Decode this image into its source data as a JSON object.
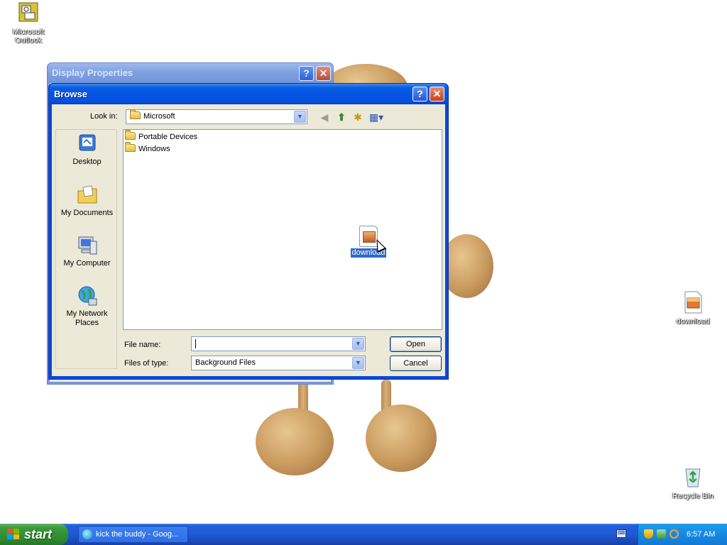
{
  "desktop": {
    "icons": [
      {
        "label": "Microsoft Outlook",
        "icon": "outlook-icon"
      },
      {
        "label": "download",
        "icon": "image-file-icon"
      },
      {
        "label": "Recycle Bin",
        "icon": "recycle-bin-icon"
      }
    ]
  },
  "display_properties": {
    "title": "Display Properties",
    "help_glyph": "?",
    "close_glyph": "✕"
  },
  "browse": {
    "title": "Browse",
    "help_glyph": "?",
    "close_glyph": "✕",
    "look_in_label": "Look in:",
    "look_in_value": "Microsoft",
    "places": [
      {
        "label": "Desktop",
        "icon": "desktop-icon"
      },
      {
        "label": "My Documents",
        "icon": "my-documents-icon"
      },
      {
        "label": "My Computer",
        "icon": "my-computer-icon"
      },
      {
        "label": "My Network Places",
        "icon": "network-places-icon"
      }
    ],
    "files": [
      {
        "name": "Portable Devices",
        "type": "folder"
      },
      {
        "name": "Windows",
        "type": "folder"
      }
    ],
    "dragged_item_label": "download",
    "file_name_label": "File name:",
    "file_name_value": "",
    "files_of_type_label": "Files of type:",
    "files_of_type_value": "Background Files",
    "open_label": "Open",
    "cancel_label": "Cancel",
    "nav_glyphs": {
      "back": "◀",
      "up": "⬆",
      "new_folder": "✱",
      "view": "▦▾"
    }
  },
  "taskbar": {
    "start_label": "start",
    "task_label": "kick the buddy - Goog...",
    "clock": "6:57 AM",
    "keyboard_glyph": "⌨"
  },
  "colors": {
    "title_active": "#0554e3",
    "title_inactive": "#7a96df",
    "dialog_face": "#ece9d8",
    "selection": "#316ac5",
    "taskbar": "#245edb",
    "start": "#3c9a3c"
  }
}
